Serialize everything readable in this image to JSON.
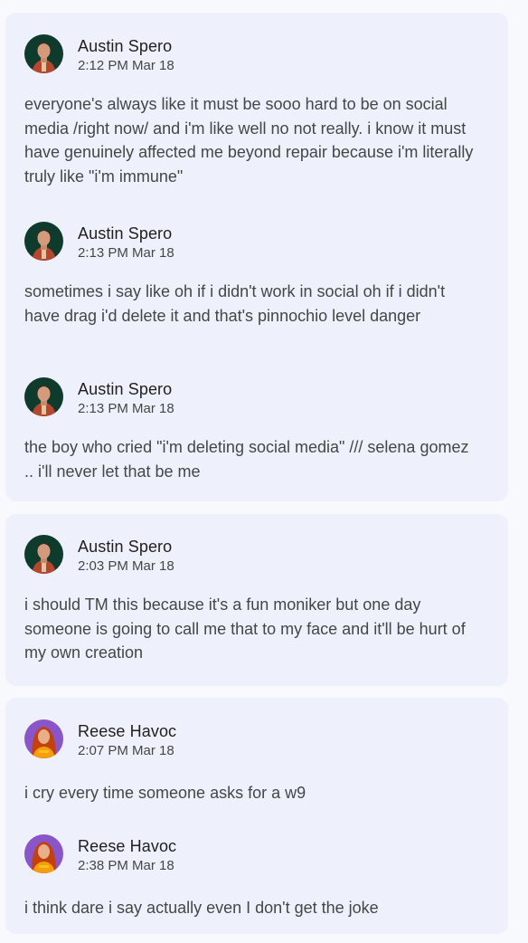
{
  "threads": [
    {
      "messages": [
        {
          "author": "Austin Spero",
          "time": "2:12 PM Mar 18",
          "text": "everyone's always like it must be sooo hard to be on social media /right now/ and i'm like well no not really. i know it must have genuinely affected me beyond repair because i'm literally truly like \"i'm immune\"",
          "avatar_icon": "austin-avatar-icon"
        },
        {
          "author": "Austin Spero",
          "time": "2:13 PM Mar 18",
          "text": "sometimes i say like oh if i didn't work in social oh if i didn't have drag i'd delete it and that's pinnochio level danger",
          "avatar_icon": "austin-avatar-icon"
        },
        {
          "author": "Austin Spero",
          "time": "2:13 PM Mar 18",
          "text": "the boy who cried \"i'm deleting social media\" /// selena gomez .. i'll never let that be me",
          "avatar_icon": "austin-avatar-icon"
        }
      ]
    },
    {
      "messages": [
        {
          "author": "Austin Spero",
          "time": "2:03 PM Mar 18",
          "text": "i should TM this because it's a fun moniker but one day someone is going to call me that to my face and it'll be hurt of my own creation",
          "avatar_icon": "austin-avatar-icon"
        }
      ]
    },
    {
      "messages": [
        {
          "author": "Reese Havoc",
          "time": "2:07 PM Mar 18",
          "text": "i cry every time someone asks for a w9",
          "avatar_icon": "reese-avatar-icon"
        },
        {
          "author": "Reese Havoc",
          "time": "2:38 PM Mar 18",
          "text": "i think dare i say actually even I  don't get the joke",
          "avatar_icon": "reese-avatar-icon"
        }
      ]
    }
  ],
  "colors": {
    "page_background": "#f8f9fc",
    "card_background": "#eef1fb",
    "author_text": "#1f1f1f",
    "body_text": "#444746",
    "austin_avatar_bg": "#0f3b2c",
    "reese_avatar_bg": "#8a55c8"
  }
}
